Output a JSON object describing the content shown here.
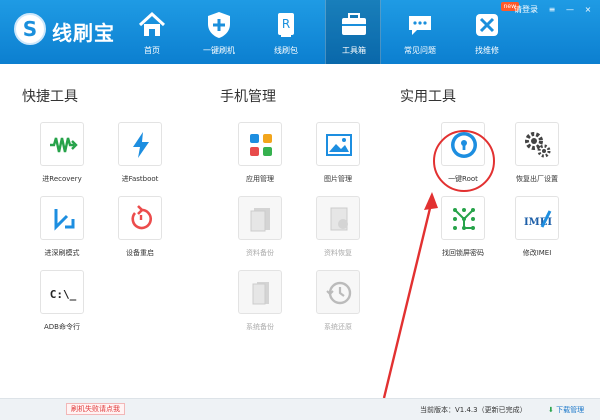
{
  "app": {
    "brand": "线刷宝",
    "login": "请登录"
  },
  "window_controls": {
    "menu": "≡",
    "minimize": "—",
    "close": "×"
  },
  "nav": [
    {
      "label": "首页"
    },
    {
      "label": "一键刷机"
    },
    {
      "label": "线刷包"
    },
    {
      "label": "工具箱"
    },
    {
      "label": "常见问题"
    },
    {
      "label": "找维修",
      "badge": "new"
    }
  ],
  "sections": {
    "quick": "快捷工具",
    "phone": "手机管理",
    "utility": "实用工具"
  },
  "tiles": {
    "recovery": "进Recovery",
    "fastboot": "进Fastboot",
    "deep_flash": "进深刷模式",
    "reboot": "设备重启",
    "adb": "ADB命令行",
    "adb_icon_text": "C:\\_",
    "app_manage": "应用管理",
    "photo_manage": "图片管理",
    "data_backup": "资料备份",
    "data_restore": "资料恢复",
    "system_backup": "系统备份",
    "system_restore": "系统还原",
    "root": "一键Root",
    "factory_reset": "恢复出厂设置",
    "unlock_pattern": "找回锁屏密码",
    "modify_imei": "修改IMEI",
    "imei_icon_text": "IMEI"
  },
  "footer": {
    "fail_text": "刷机失败请点我",
    "version": "当前版本：V1.4.3（更新已完成）",
    "download": "下载管理"
  },
  "colors": {
    "header_top": "#1f9be4",
    "header_bottom": "#0c7fd0",
    "accent_red": "#e23131"
  }
}
